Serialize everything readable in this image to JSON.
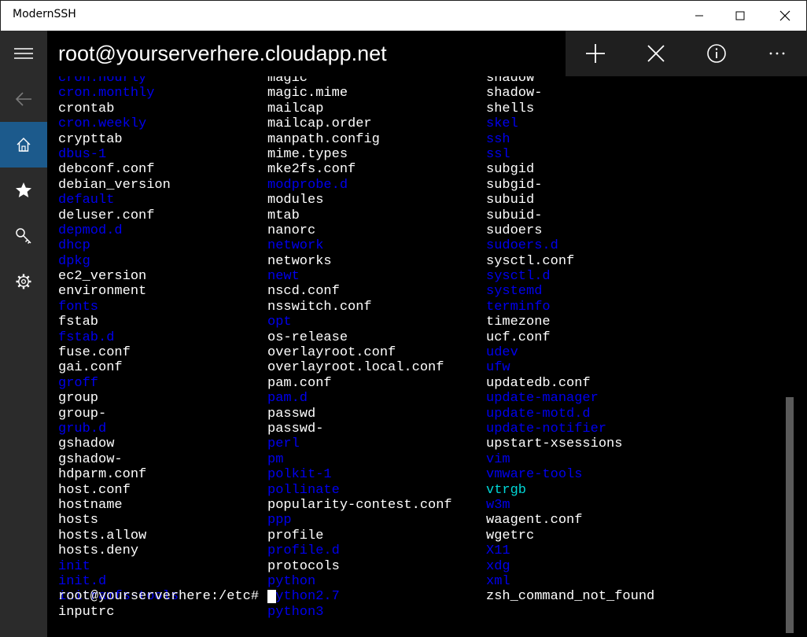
{
  "window": {
    "title": "ModernSSH",
    "controls": [
      "minimize-icon",
      "maximize-icon",
      "close-icon"
    ]
  },
  "sidebar": {
    "items": [
      {
        "name": "menu",
        "icon": "hamburger-icon"
      },
      {
        "name": "back",
        "icon": "back-arrow-icon"
      },
      {
        "name": "home",
        "icon": "home-icon",
        "active": true
      },
      {
        "name": "favorites",
        "icon": "star-icon"
      },
      {
        "name": "keys",
        "icon": "key-icon"
      },
      {
        "name": "settings",
        "icon": "gear-icon"
      }
    ],
    "active_color": "#1c5a8c"
  },
  "header": {
    "host": "root@yourserverhere.cloudapp.net"
  },
  "toolbar": {
    "buttons": [
      {
        "name": "new-session",
        "icon": "plus-icon"
      },
      {
        "name": "close-session",
        "icon": "x-icon"
      },
      {
        "name": "info",
        "icon": "info-icon"
      },
      {
        "name": "more",
        "icon": "more-icon"
      }
    ]
  },
  "terminal": {
    "colors": {
      "file": "#ffffff",
      "dir": "#0000ee",
      "link": "#00d6d6"
    },
    "columns": [
      [
        {
          "t": "cron.hourly",
          "k": "dir"
        },
        {
          "t": "cron.monthly",
          "k": "dir"
        },
        {
          "t": "crontab",
          "k": "file"
        },
        {
          "t": "cron.weekly",
          "k": "dir"
        },
        {
          "t": "crypttab",
          "k": "file"
        },
        {
          "t": "dbus-1",
          "k": "dir"
        },
        {
          "t": "debconf.conf",
          "k": "file"
        },
        {
          "t": "debian_version",
          "k": "file"
        },
        {
          "t": "default",
          "k": "dir"
        },
        {
          "t": "deluser.conf",
          "k": "file"
        },
        {
          "t": "depmod.d",
          "k": "dir"
        },
        {
          "t": "dhcp",
          "k": "dir"
        },
        {
          "t": "dpkg",
          "k": "dir"
        },
        {
          "t": "ec2_version",
          "k": "file"
        },
        {
          "t": "environment",
          "k": "file"
        },
        {
          "t": "fonts",
          "k": "dir"
        },
        {
          "t": "fstab",
          "k": "file"
        },
        {
          "t": "fstab.d",
          "k": "dir"
        },
        {
          "t": "fuse.conf",
          "k": "file"
        },
        {
          "t": "gai.conf",
          "k": "file"
        },
        {
          "t": "groff",
          "k": "dir"
        },
        {
          "t": "group",
          "k": "file"
        },
        {
          "t": "group-",
          "k": "file"
        },
        {
          "t": "grub.d",
          "k": "dir"
        },
        {
          "t": "gshadow",
          "k": "file"
        },
        {
          "t": "gshadow-",
          "k": "file"
        },
        {
          "t": "hdparm.conf",
          "k": "file"
        },
        {
          "t": "host.conf",
          "k": "file"
        },
        {
          "t": "hostname",
          "k": "file"
        },
        {
          "t": "hosts",
          "k": "file"
        },
        {
          "t": "hosts.allow",
          "k": "file"
        },
        {
          "t": "hosts.deny",
          "k": "file"
        },
        {
          "t": "init",
          "k": "dir"
        },
        {
          "t": "init.d",
          "k": "dir"
        },
        {
          "t": "initramfs-tools",
          "k": "dir"
        },
        {
          "t": "inputrc",
          "k": "file"
        }
      ],
      [
        {
          "t": "magic",
          "k": "file"
        },
        {
          "t": "magic.mime",
          "k": "file"
        },
        {
          "t": "mailcap",
          "k": "file"
        },
        {
          "t": "mailcap.order",
          "k": "file"
        },
        {
          "t": "manpath.config",
          "k": "file"
        },
        {
          "t": "mime.types",
          "k": "file"
        },
        {
          "t": "mke2fs.conf",
          "k": "file"
        },
        {
          "t": "modprobe.d",
          "k": "dir"
        },
        {
          "t": "modules",
          "k": "file"
        },
        {
          "t": "mtab",
          "k": "file"
        },
        {
          "t": "nanorc",
          "k": "file"
        },
        {
          "t": "network",
          "k": "dir"
        },
        {
          "t": "networks",
          "k": "file"
        },
        {
          "t": "newt",
          "k": "dir"
        },
        {
          "t": "nscd.conf",
          "k": "file"
        },
        {
          "t": "nsswitch.conf",
          "k": "file"
        },
        {
          "t": "opt",
          "k": "dir"
        },
        {
          "t": "os-release",
          "k": "file"
        },
        {
          "t": "overlayroot.conf",
          "k": "file"
        },
        {
          "t": "overlayroot.local.conf",
          "k": "file"
        },
        {
          "t": "pam.conf",
          "k": "file"
        },
        {
          "t": "pam.d",
          "k": "dir"
        },
        {
          "t": "passwd",
          "k": "file"
        },
        {
          "t": "passwd-",
          "k": "file"
        },
        {
          "t": "perl",
          "k": "dir"
        },
        {
          "t": "pm",
          "k": "dir"
        },
        {
          "t": "polkit-1",
          "k": "dir"
        },
        {
          "t": "pollinate",
          "k": "dir"
        },
        {
          "t": "popularity-contest.conf",
          "k": "file"
        },
        {
          "t": "ppp",
          "k": "dir"
        },
        {
          "t": "profile",
          "k": "file"
        },
        {
          "t": "profile.d",
          "k": "dir"
        },
        {
          "t": "protocols",
          "k": "file"
        },
        {
          "t": "python",
          "k": "dir"
        },
        {
          "t": "python2.7",
          "k": "dir"
        },
        {
          "t": "python3",
          "k": "dir"
        }
      ],
      [
        {
          "t": "shadow",
          "k": "file"
        },
        {
          "t": "shadow-",
          "k": "file"
        },
        {
          "t": "shells",
          "k": "file"
        },
        {
          "t": "skel",
          "k": "dir"
        },
        {
          "t": "ssh",
          "k": "dir"
        },
        {
          "t": "ssl",
          "k": "dir"
        },
        {
          "t": "subgid",
          "k": "file"
        },
        {
          "t": "subgid-",
          "k": "file"
        },
        {
          "t": "subuid",
          "k": "file"
        },
        {
          "t": "subuid-",
          "k": "file"
        },
        {
          "t": "sudoers",
          "k": "file"
        },
        {
          "t": "sudoers.d",
          "k": "dir"
        },
        {
          "t": "sysctl.conf",
          "k": "file"
        },
        {
          "t": "sysctl.d",
          "k": "dir"
        },
        {
          "t": "systemd",
          "k": "dir"
        },
        {
          "t": "terminfo",
          "k": "dir"
        },
        {
          "t": "timezone",
          "k": "file"
        },
        {
          "t": "ucf.conf",
          "k": "file"
        },
        {
          "t": "udev",
          "k": "dir"
        },
        {
          "t": "ufw",
          "k": "dir"
        },
        {
          "t": "updatedb.conf",
          "k": "file"
        },
        {
          "t": "update-manager",
          "k": "dir"
        },
        {
          "t": "update-motd.d",
          "k": "dir"
        },
        {
          "t": "update-notifier",
          "k": "dir"
        },
        {
          "t": "upstart-xsessions",
          "k": "file"
        },
        {
          "t": "vim",
          "k": "dir"
        },
        {
          "t": "vmware-tools",
          "k": "dir"
        },
        {
          "t": "vtrgb",
          "k": "link"
        },
        {
          "t": "w3m",
          "k": "dir"
        },
        {
          "t": "waagent.conf",
          "k": "file"
        },
        {
          "t": "wgetrc",
          "k": "file"
        },
        {
          "t": "X11",
          "k": "dir"
        },
        {
          "t": "xdg",
          "k": "dir"
        },
        {
          "t": "xml",
          "k": "dir"
        },
        {
          "t": "zsh_command_not_found",
          "k": "file"
        }
      ]
    ],
    "prompt": "root@yourserverhere:/etc# "
  }
}
